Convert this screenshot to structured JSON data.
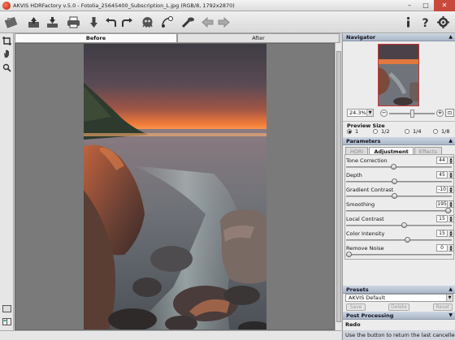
{
  "window": {
    "title": "AKVIS HDRFactory v.5.0 - Fotolia_25645400_Subscription_L.jpg (RGB/8, 1792x2870)",
    "minimize": "–",
    "maximize": "□",
    "close": "✕"
  },
  "toolbar": {
    "icons": [
      "open-icon",
      "save-icon",
      "print-icon",
      "load-settings-icon",
      "undo-icon",
      "redo-icon",
      "run-icon",
      "batch-icon",
      "magic-icon",
      "back-icon",
      "forward-icon",
      "info-icon",
      "help-icon",
      "preferences-icon"
    ]
  },
  "left_tools": [
    "crop-icon",
    "hand-icon",
    "zoom-icon",
    "before-after-icon",
    "compare-icon"
  ],
  "view_tabs": {
    "before": "Before",
    "after": "After",
    "active": "before"
  },
  "navigator": {
    "title": "Navigator",
    "zoom": "24.3%",
    "zoom_level": 0.5,
    "minus": "−",
    "plus": "+",
    "fit": "⊡"
  },
  "preview_size": {
    "title": "Preview Size",
    "options": [
      "1",
      "1/2",
      "1/4",
      "1/8"
    ],
    "selected": "1"
  },
  "parameters": {
    "title": "Parameters",
    "tabs": [
      "HDRI",
      "Adjustment",
      "Effects"
    ],
    "active_tab": "Adjustment",
    "items": [
      {
        "label": "Tone Correction",
        "value": "44",
        "level": 0.44
      },
      {
        "label": "Depth",
        "value": "45",
        "level": 0.45
      },
      {
        "label": "Gradient Contrast",
        "value": "-10",
        "level": 0.45
      },
      {
        "label": "Smoothing",
        "value": "195",
        "level": 0.98
      },
      {
        "label": "Local Contrast",
        "value": "15",
        "level": 0.55
      },
      {
        "label": "Color Intensity",
        "value": "15",
        "level": 0.58
      },
      {
        "label": "Remove Noise",
        "value": "0",
        "level": 0.0
      }
    ]
  },
  "presets": {
    "title": "Presets",
    "selected": "AKVIS Default",
    "save": "Save",
    "delete": "Delete",
    "reset": "Reset"
  },
  "post_processing": {
    "title": "Post Processing"
  },
  "redo_panel": {
    "title": "Redo",
    "hint": "Use the button to return the last cancelled"
  },
  "colors": {
    "accent": "#c0392b",
    "panel_header": "#aab7c8",
    "canvas_bg": "#7a7a7a"
  }
}
